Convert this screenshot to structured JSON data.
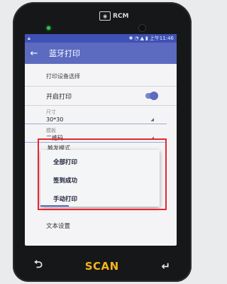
{
  "device": {
    "logo_text": "RCM",
    "scan_label": "SCAN"
  },
  "statusbar": {
    "left_icon": "lock-icon",
    "bluetooth": "✱",
    "wifi": "◔",
    "signal": "▲",
    "battery": "▮",
    "time": "上午11:46"
  },
  "appbar": {
    "back_icon": "back-arrow-icon",
    "title": "蓝牙打印"
  },
  "settings": {
    "section_print_device": "打印设备选择",
    "toggle_print_label": "开启打印",
    "size_label": "尺寸",
    "size_value": "30*30",
    "template_label": "模板",
    "template_value": "二维码",
    "trigger_mode_label": "触发模式",
    "text_settings_label": "文本设置"
  },
  "popup": {
    "options": [
      "全部打印",
      "签到成功",
      "手动打印"
    ]
  },
  "keys": {
    "back_symbol": "⮌",
    "enter_symbol": "↵"
  },
  "colors": {
    "appbar": "#5c6bc0",
    "statusbar": "#3f51b5",
    "highlight": "#e8262d",
    "scan": "#f2b51d"
  }
}
